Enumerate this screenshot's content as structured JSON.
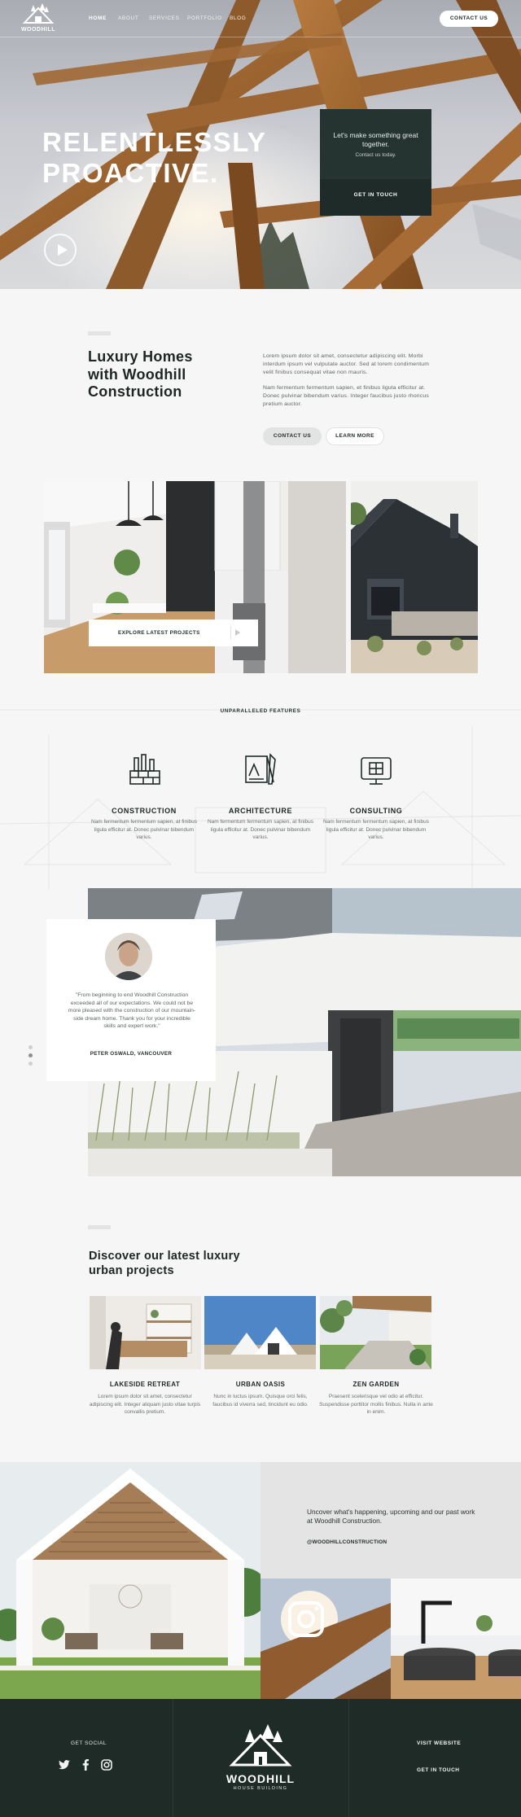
{
  "nav": {
    "logo_text": "WOODHILL",
    "items": [
      {
        "label": "HOME",
        "active": true
      },
      {
        "label": "ABOUT",
        "active": false
      },
      {
        "label": "SERVICES",
        "active": false
      },
      {
        "label": "PORTFOLIO",
        "active": false
      },
      {
        "label": "BLOG",
        "active": false
      }
    ],
    "contact_button": "CONTACT US"
  },
  "hero": {
    "title_line1": "RELENTLESSLY",
    "title_line2": "PROACTIVE.",
    "card_text": "Let's make something great together.",
    "card_subtext": "Contact us today.",
    "card_button": "GET IN TOUCH"
  },
  "intro": {
    "title": "Luxury Homes with Woodhill Construction",
    "paragraph1": "Lorem ipsum dolor sit amet, consectetur adipiscing elit. Morbi interdum ipsum vel vulputate auctor. Sed at lorem condimentum velit finibus consequat vitae non mauris.",
    "paragraph2": "Nam fermentum fermentum sapien, et finibus ligula efficitur at. Donec pulvinar bibendum varius. Integer faucibus justo rhoncus pretium auctor.",
    "button_primary": "CONTACT US",
    "button_secondary": "LEARN MORE"
  },
  "gallery": {
    "explore_label": "EXPLORE LATEST PROJECTS"
  },
  "features": {
    "label": "UNPARALLELED FEATURES",
    "items": [
      {
        "title": "CONSTRUCTION",
        "text": "Nam fermentum fermentum sapien, at finibus ligula efficitur at. Donec pulvinar bibendum varius.",
        "icon": "construction-bricks-icon"
      },
      {
        "title": "ARCHITECTURE",
        "text": "Nam fermentum fermentum sapien, at finibus ligula efficitur at. Donec pulvinar bibendum varius.",
        "icon": "architecture-tools-icon"
      },
      {
        "title": "CONSULTING",
        "text": "Nam fermentum fermentum sapien, at finibus ligula efficitur at. Donec pulvinar bibendum varius.",
        "icon": "consulting-blueprint-icon"
      }
    ]
  },
  "testimonial": {
    "quote": "\"From beginning to end Woodhill Construction exceeded all of our expectations. We could not be more pleased with the construction of our mountain-side dream home. Thank you for your incredible skills and expert work.\"",
    "author": "PETER OSWALD, VANCOUVER",
    "slides": 3,
    "active_slide": 2
  },
  "projects": {
    "title": "Discover our latest luxury urban projects",
    "items": [
      {
        "name": "LAKESIDE RETREAT",
        "text": "Lorem ipsum dolor sit amet, consectetur adipiscing elit. Integer aliquam justo vitae turpis convallis pretium."
      },
      {
        "name": "URBAN OASIS",
        "text": "Nunc in luctus ipsum. Quisque orci felis, faucibus id viverra sed, tincidunt eu odio."
      },
      {
        "name": "ZEN GARDEN",
        "text": "Praesent scelerisque vel odio at efficitur. Suspendisse porttitor mollis finibus. Nulla in ante in enim."
      }
    ]
  },
  "social": {
    "text": "Uncover what's happening, upcoming and our past work at Woodhill Construction.",
    "handle": "@WOODHILLCONSTRUCTION"
  },
  "footer": {
    "social_label": "GET SOCIAL",
    "logo_text": "WOODHILL",
    "logo_subtext": "HOUSE BUILDING",
    "link_website": "VISIT WEBSITE",
    "link_touch": "GET IN TOUCH",
    "social_icons": [
      "twitter-icon",
      "facebook-icon",
      "instagram-icon"
    ]
  },
  "colors": {
    "brand_dark": "#1f2b28",
    "footer": "#1e2b27",
    "background": "#f6f6f6"
  }
}
